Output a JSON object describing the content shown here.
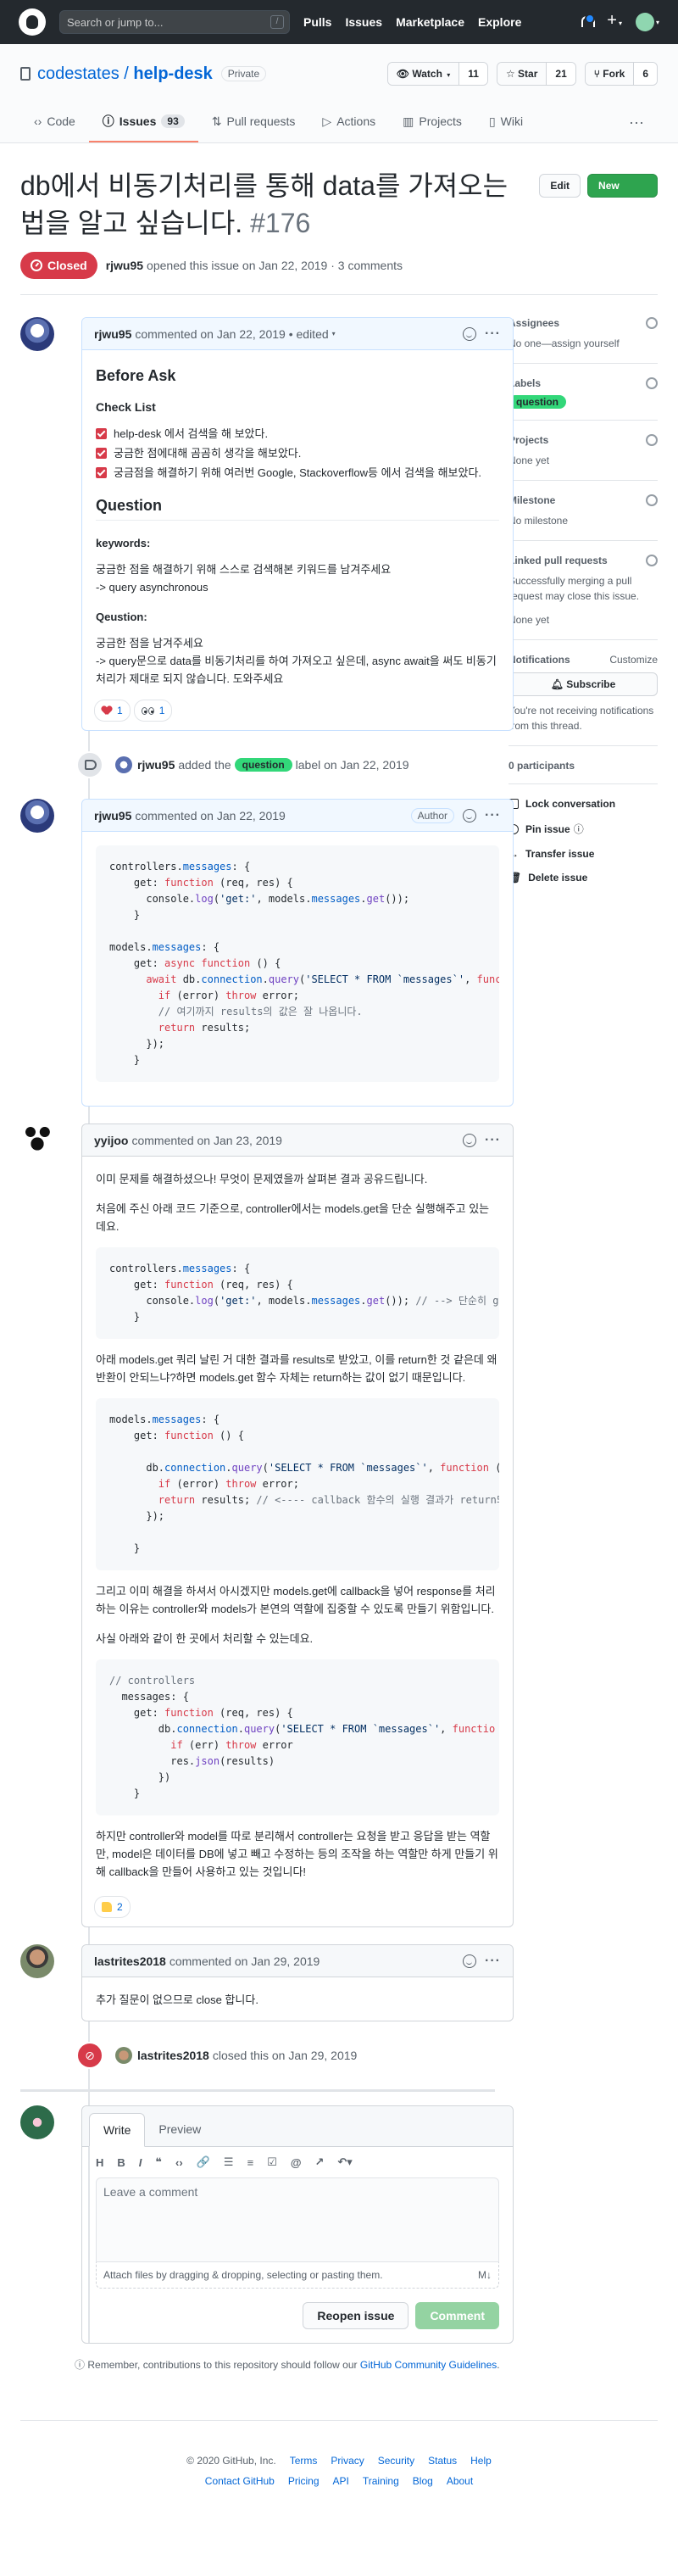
{
  "header": {
    "search_placeholder": "Search or jump to...",
    "slash_key": "/",
    "nav": [
      "Pulls",
      "Issues",
      "Marketplace",
      "Explore"
    ]
  },
  "repo": {
    "owner": "codestates",
    "sep": "/",
    "name": "help-desk",
    "visibility": "Private",
    "watch": {
      "label": "Watch",
      "count": "11"
    },
    "star": {
      "label": "Star",
      "count": "21"
    },
    "fork": {
      "label": "Fork",
      "count": "6"
    },
    "tabs": [
      {
        "label": "Code"
      },
      {
        "label": "Issues",
        "count": "93"
      },
      {
        "label": "Pull requests"
      },
      {
        "label": "Actions"
      },
      {
        "label": "Projects"
      },
      {
        "label": "Wiki"
      }
    ]
  },
  "issue": {
    "title": "db에서 비동기처리를 통해 data를 가져오는 법을 알고 싶습니다.",
    "number": "#176",
    "edit_label": "Edit",
    "new_label": "New issue",
    "status": "Closed",
    "author": "rjwu95",
    "opened_text": "opened this issue on Jan 22, 2019 · 3 comments"
  },
  "c1": {
    "author": "rjwu95",
    "meta": "commented on Jan 22, 2019 • edited",
    "h_before": "Before Ask",
    "h_check": "Check List",
    "checks": [
      "help-desk 에서 검색을 해 보았다.",
      "궁금한 점에대해 곰곰히 생각을 해보았다.",
      "궁금점을 해결하기 위해 여러번 Google, Stackoverflow등 에서 검색을 해보았다."
    ],
    "h_question": "Question",
    "kw_label": "keywords:",
    "kw_text1": "궁금한 점을 해결하기 위해 스스로 검색해본 키워드를 남겨주세요",
    "kw_text2": "-> query asynchronous",
    "q_label": "Qeustion:",
    "q_text1": "궁금한 점을 남겨주세요",
    "q_text2": "-> query문으로 data를 비동기처리를 하여 가져오고 싶은데, async await을 써도 비동기 처리가 제대로 되지 않습니다. 도와주세요",
    "r_heart": "1",
    "r_eyes": "1"
  },
  "ev_label": {
    "author": "rjwu95",
    "pre": "added the",
    "label": "question",
    "post": "label on Jan 22, 2019"
  },
  "c2": {
    "author": "rjwu95",
    "meta": "commented on Jan 22, 2019",
    "assoc": "Author"
  },
  "c3": {
    "author": "yyijoo",
    "meta": "commented on Jan 23, 2019",
    "p1": "이미 문제를 해결하셨으나! 무엇이 문제였을까 살펴본 결과 공유드립니다.",
    "p2": "처음에 주신 아래 코드 기준으로, controller에서는 models.get을 단순 실행해주고 있는데요.",
    "p3": "아래 models.get 쿼리 날린 거 대한 결과를 results로 받았고, 이를 return한 것 같은데 왜 반환이 안되느냐?하면 models.get 함수 자체는 return하는 값이 없기 때문입니다.",
    "p4": "그리고 이미 해결을 하셔서 아시겠지만 models.get에 callback을 넣어 response를 처리하는 이유는 controller와 models가 본연의 역할에 집중할 수 있도록 만들기 위함입니다.",
    "p5": "사실 아래와 같이 한 곳에서 처리할 수 있는데요.",
    "p6": "하지만 controller와 model를 따로 분리해서 controller는 요청을 받고 응답을 받는 역할만, model은 데이터를 DB에 넣고 빼고 수정하는 등의 조작을 하는 역할만 하게 만들기 위해 callback을 만들어 사용하고 있는 것입니다!",
    "r_thumb": "2"
  },
  "c4": {
    "author": "lastrites2018",
    "meta": "commented on Jan 29, 2019",
    "body": "추가 질문이 없으므로 close 합니다."
  },
  "ev_close": {
    "author": "lastrites2018",
    "text": "closed this on Jan 29, 2019"
  },
  "composer": {
    "write": "Write",
    "preview": "Preview",
    "placeholder": "Leave a comment",
    "attach": "Attach files by dragging & dropping, selecting or pasting them.",
    "reopen": "Reopen issue",
    "comment": "Comment",
    "note_pre": "Remember, contributions to this repository should follow our",
    "note_link": "GitHub Community Guidelines",
    "note_post": "."
  },
  "sidebar": {
    "assignees": "Assignees",
    "assignees_val": "No one—assign yourself",
    "labels": "Labels",
    "label_val": "question",
    "projects": "Projects",
    "projects_val": "None yet",
    "milestone": "Milestone",
    "milestone_val": "No milestone",
    "linked": "Linked pull requests",
    "linked_txt": "Successfully merging a pull request may close this issue.",
    "linked_val": "None yet",
    "notif": "Notifications",
    "customize": "Customize",
    "subscribe": "Subscribe",
    "notif_txt": "You're not receiving notifications from this thread.",
    "participants": "0 participants",
    "lock": "Lock conversation",
    "pin": "Pin issue",
    "transfer": "Transfer issue",
    "delete": "Delete issue"
  },
  "footer": {
    "copy": "© 2020 GitHub, Inc.",
    "row1": [
      "Terms",
      "Privacy",
      "Security",
      "Status",
      "Help"
    ],
    "row2": [
      "Contact GitHub",
      "Pricing",
      "API",
      "Training",
      "Blog",
      "About"
    ]
  },
  "colors": {
    "header_bg": "#24292e",
    "closed": "#d73a49",
    "label_question": "#32d779",
    "primary": "#2ea44f",
    "link": "#0366d6"
  }
}
